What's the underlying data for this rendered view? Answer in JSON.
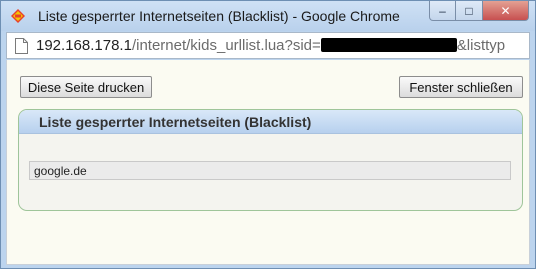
{
  "window": {
    "title": "Liste gesperrter Internetseiten (Blacklist) - Google Chrome",
    "app_icon": "fritzbox-icon",
    "controls": {
      "minimize": "–",
      "maximize": "□",
      "close": "✕"
    }
  },
  "address_bar": {
    "host": "192.168.178.1",
    "path": "/internet/kids_urllist.lua?sid=",
    "suffix": "&listtyp",
    "page_icon": "page-icon"
  },
  "toolbar": {
    "print_label": "Diese Seite drucken",
    "close_label": "Fenster schließen"
  },
  "panel": {
    "title": "Liste gesperrter Internetseiten (Blacklist)",
    "items": [
      "google.de"
    ]
  },
  "colors": {
    "panel_header": "#c6dbf3",
    "panel_border": "#9fc59a",
    "content_bg": "#fbfbf2"
  }
}
